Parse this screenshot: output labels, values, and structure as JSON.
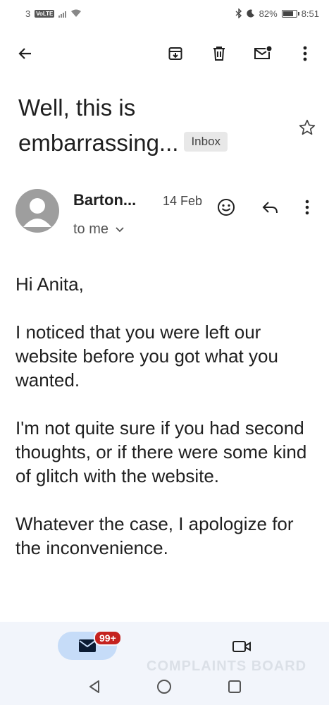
{
  "status_bar": {
    "network_badge": "VoLTE",
    "sim": "3",
    "battery": "82%",
    "battery_level": 0.82,
    "time": "8:51"
  },
  "app_bar": {
    "icons": [
      "back-arrow-icon",
      "archive-icon",
      "delete-icon",
      "mark-unread-icon",
      "more-vert-icon"
    ]
  },
  "email": {
    "subject_line1": "Well, this is",
    "subject_line2": "embarrassing...",
    "label_chip": "Inbox",
    "sender_name": "Barton...",
    "date": "14 Feb",
    "recipient": "to me",
    "body": [
      "Hi Anita,",
      "I noticed that you were left our website before you got what you wanted.",
      "I'm not quite sure if you had second thoughts, or if there were some kind of glitch with the website.",
      "Whatever the case, I apologize for the inconvenience."
    ]
  },
  "bottom_nav": {
    "mail_badge": "99+",
    "watermark": "COMPLAINTS BOARD"
  },
  "colors": {
    "nav_background": "#f2f5fb",
    "active_pill": "#c6dcf8",
    "badge": "#c5221f",
    "avatar": "#9e9e9e"
  }
}
